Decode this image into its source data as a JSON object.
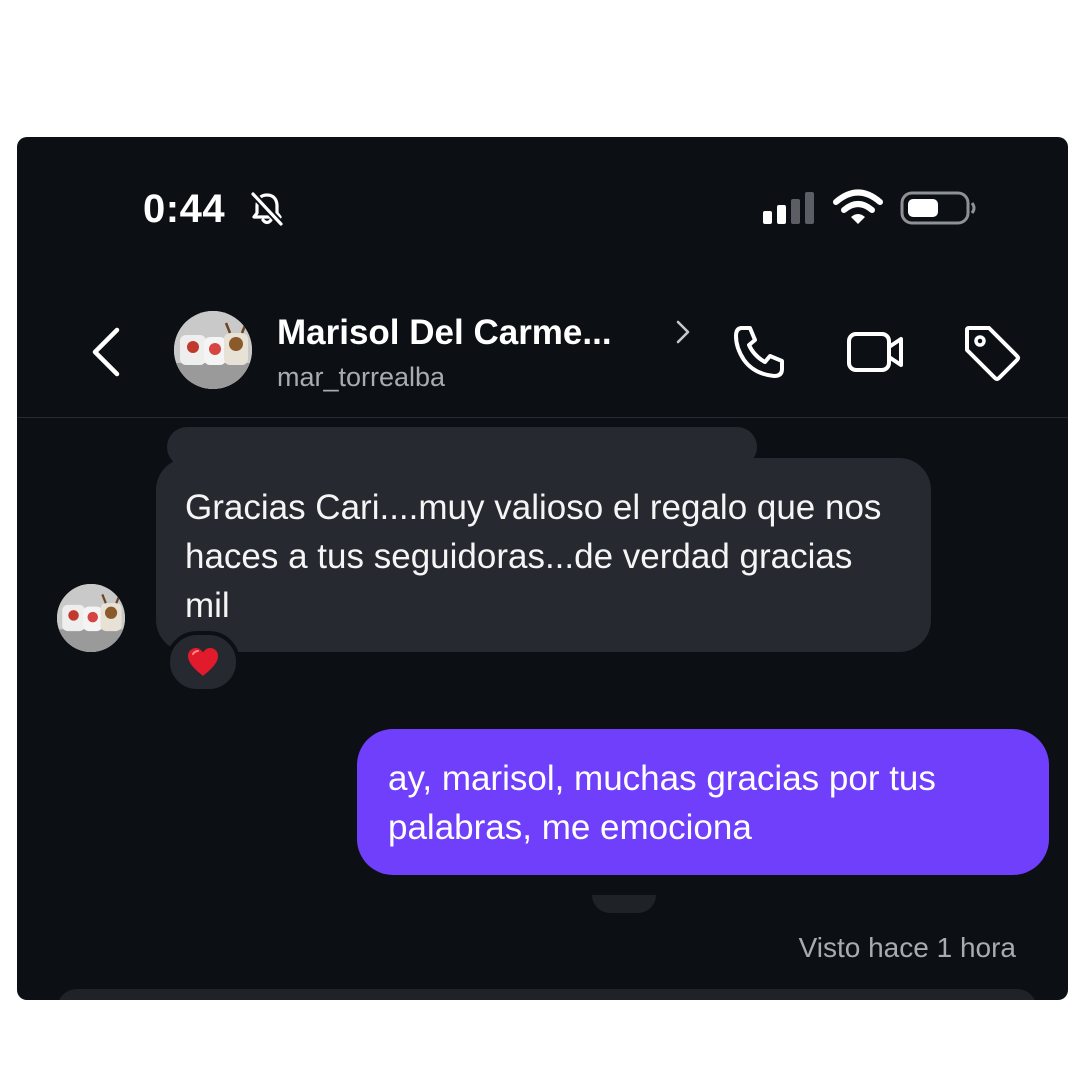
{
  "status_bar": {
    "time": "0:44",
    "icons": [
      "bell-slash-icon",
      "cellular-signal-icon",
      "wifi-icon",
      "battery-icon"
    ]
  },
  "header": {
    "contact_name": "Marisol Del Carme...",
    "contact_handle": "mar_torrealba",
    "actions": [
      "phone-icon",
      "video-camera-icon",
      "tag-icon"
    ]
  },
  "messages": [
    {
      "direction": "incoming",
      "text": "Gracias Cari....muy valioso el regalo que nos haces a tus seguidoras...de verdad gracias mil",
      "reaction": "❤️"
    },
    {
      "direction": "outgoing",
      "text": "ay, marisol, muchas gracias por tus palabras, me emociona"
    }
  ],
  "seen_status": "Visto hace 1 hora",
  "colors": {
    "background": "#0c1014",
    "incoming_bubble": "#262a30",
    "outgoing_bubble": "#6f3ffb",
    "secondary_text": "#a8acb2"
  }
}
